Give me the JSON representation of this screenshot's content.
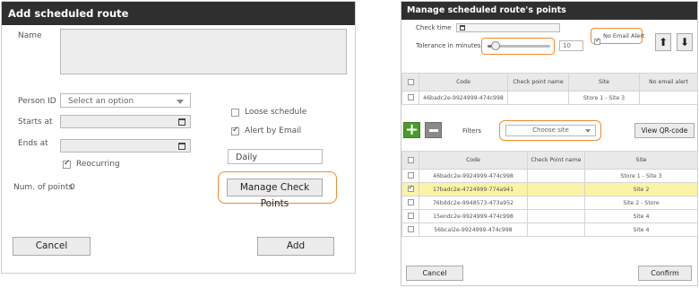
{
  "left": {
    "title": "Add scheduled route",
    "name_label": "Name",
    "person_label": "Person ID",
    "person_placeholder": "Select an option",
    "starts_label": "Starts at",
    "ends_label": "Ends at",
    "reocurring_label": "Reocurring",
    "reocurring_checked": true,
    "loose_label": "Loose schedule",
    "loose_checked": false,
    "alert_label": "Alert by Email",
    "alert_checked": true,
    "frequency_value": "Daily",
    "manage_button": "Manage Check Points",
    "num_points_label": "Num. of points",
    "num_points_value": "0",
    "cancel_button": "Cancel",
    "add_button": "Add"
  },
  "right": {
    "title": "Manage scheduled route's points",
    "check_time_label": "Check time",
    "tolerance_label": "Tolerance in minutes",
    "tolerance_value": "10",
    "slider_fraction": 0.13,
    "no_email_label": "No Email Alert",
    "no_email_checked": true,
    "top_table": {
      "headers": [
        "Code",
        "Check point name",
        "Site",
        "No email alert"
      ],
      "rows": [
        {
          "code": "46badc2e-9924999-474c998",
          "name": "",
          "site": "Store 1 - Site 3",
          "alert": ""
        }
      ]
    },
    "filters_label": "Filters",
    "site_placeholder": "Choose site",
    "qr_button": "View QR-code",
    "bottom_table": {
      "headers": [
        "Code",
        "Check Point name",
        "Site"
      ],
      "rows": [
        {
          "code": "46badc2e-9924999-474c998",
          "name": "",
          "site": "Store 1 - Site 3",
          "checked": false,
          "selected": false
        },
        {
          "code": "17badc2e-4724999-774a941",
          "name": "",
          "site": "Site 2",
          "checked": true,
          "selected": true
        },
        {
          "code": "76bddc2e-9948573-473a952",
          "name": "",
          "site": "Site 2 - Store",
          "checked": false,
          "selected": false
        },
        {
          "code": "15endc2e-9924999-474c998",
          "name": "",
          "site": "Site 4",
          "checked": false,
          "selected": false
        },
        {
          "code": "56bcal2e-9924999-474c998",
          "name": "",
          "site": "Site 4",
          "checked": false,
          "selected": false
        }
      ]
    },
    "cancel_button": "Cancel",
    "confirm_button": "Confirm",
    "accent_color": "#f28a2e",
    "add_color": "#4a9a2c",
    "selected_row_color": "#fbf3a5"
  }
}
